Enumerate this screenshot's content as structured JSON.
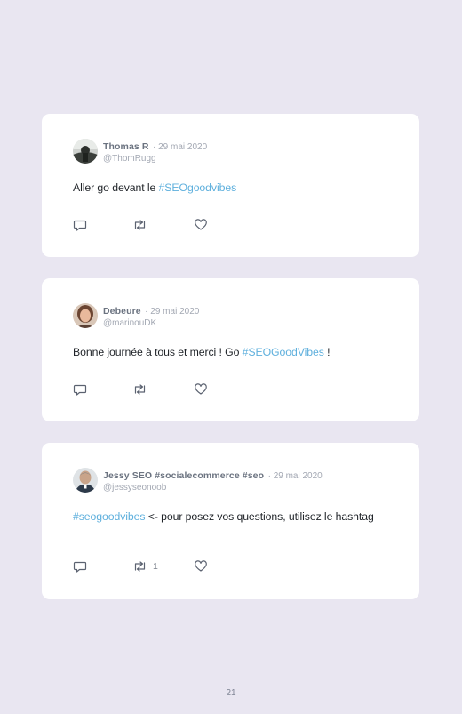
{
  "tweets": [
    {
      "author": "Thomas R",
      "date": "· 29 mai 2020",
      "handle": "@ThomRugg",
      "text_before": "Aller go devant le ",
      "hashtag": "#SEOgoodvibes",
      "text_after": "",
      "retweets": ""
    },
    {
      "author": "Debeure",
      "date": "· 29 mai 2020",
      "handle": "@marinouDK",
      "text_before": "Bonne journée à tous et merci ! Go ",
      "hashtag": "#SEOGoodVibes",
      "text_after": " !",
      "retweets": ""
    },
    {
      "author": "Jessy SEO #socialecommerce #seo",
      "date": "· 29 mai 2020",
      "handle": "@jessyseonoob",
      "text_before": "",
      "hashtag": "#seogoodvibes",
      "text_after": " <- pour posez vos questions, utilisez le hashtag",
      "retweets": "1"
    }
  ],
  "icons": {
    "reply": "reply-icon",
    "retweet": "retweet-icon",
    "like": "heart-icon"
  },
  "colors": {
    "background": "#e9e6f1",
    "card": "#ffffff",
    "hashtag": "#5fb0dd"
  },
  "page_number": "21"
}
